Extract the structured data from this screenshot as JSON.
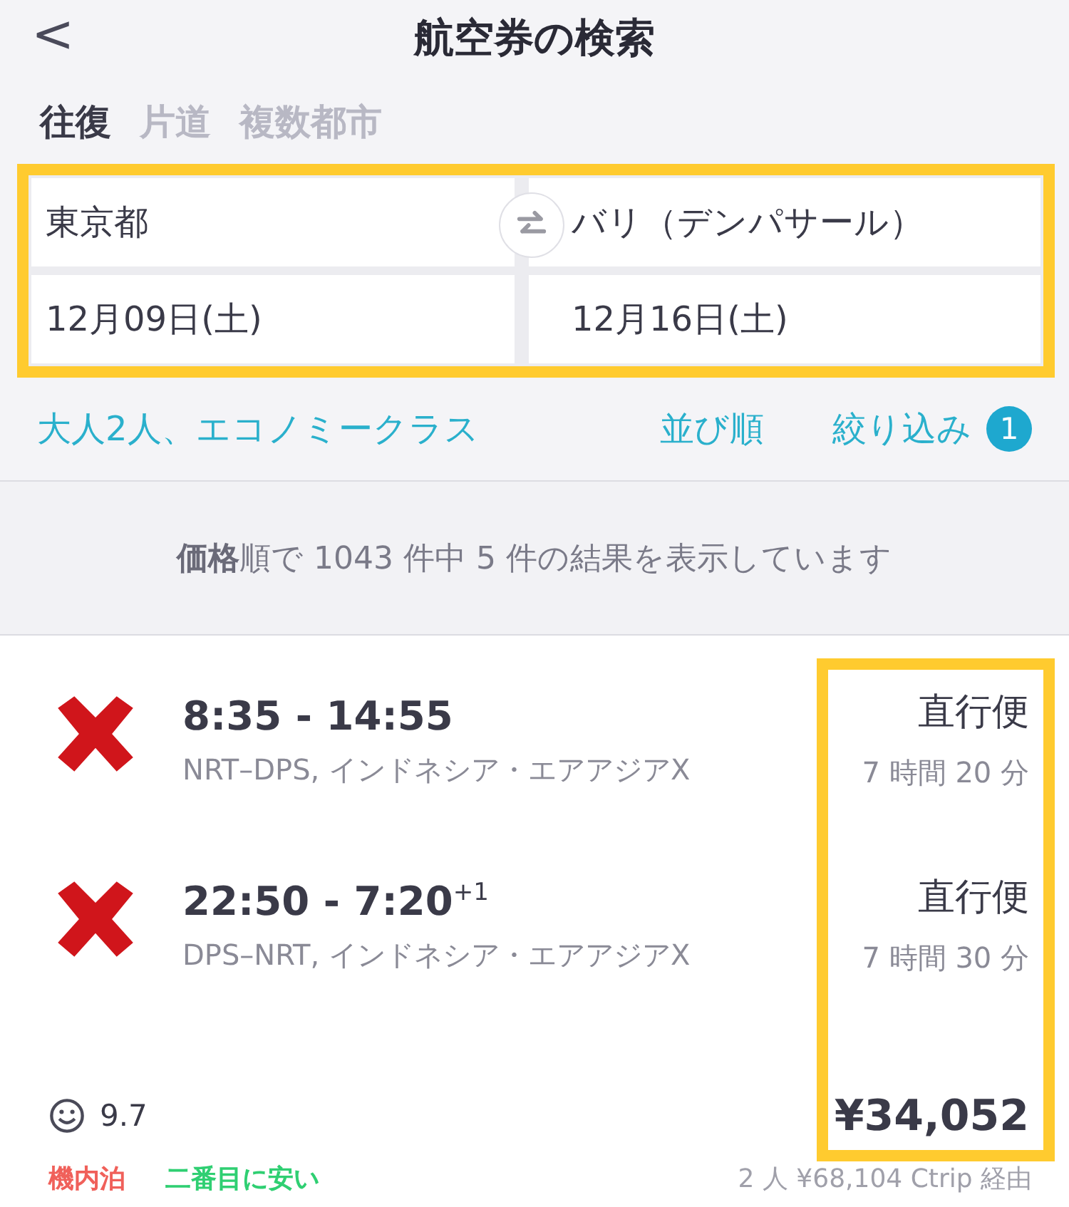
{
  "header": {
    "back": "<",
    "title": "航空券の検索"
  },
  "trip_tabs": [
    {
      "label": "往復",
      "selected": true
    },
    {
      "label": "片道",
      "selected": false
    },
    {
      "label": "複数都市",
      "selected": false
    }
  ],
  "search_form": {
    "highlighted": true,
    "origin": "東京都",
    "destination": "バリ（デンパサール）",
    "depart_date": "12月09日(土)",
    "return_date": "12月16日(土)"
  },
  "options": {
    "passengers": "大人2人、エコノミークラス",
    "sort": "並び順",
    "filter": "絞り込み",
    "filter_count": "1"
  },
  "summary": "**価格**順で 1043 件中 5 件の結果を表示しています",
  "results": [
    {
      "highlighted": true,
      "legs": [
        {
          "times": "8:35 - 14:55",
          "route": "NRT–DPS, インドネシア・エアアジアX",
          "stops": "直行便",
          "duration": "7 時間 20 分"
        },
        {
          "times": "22:50 - 7:20$^{+1}$",
          "route": "DPS–NRT, インドネシア・エアアジアX",
          "stops": "直行便",
          "duration": "7 時間 30 分"
        }
      ],
      "score": "9.7",
      "price": "¥34,052",
      "total": "2 人 ¥68,104 Ctrip 経由",
      "tags": [
        {
          "label": "機内泊",
          "color": "#f0605a"
        },
        {
          "label": "二番目に安い",
          "color": "#2fcf72"
        }
      ]
    }
  ]
}
